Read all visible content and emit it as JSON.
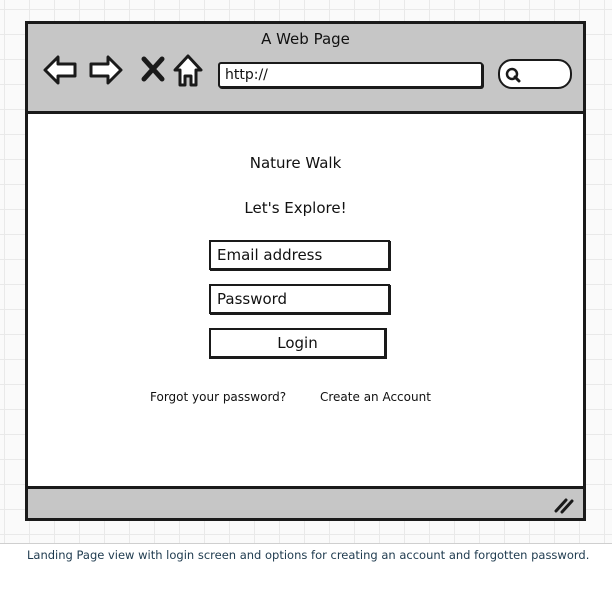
{
  "window": {
    "title": "A Web Page"
  },
  "toolbar": {
    "icons": [
      "back-arrow-icon",
      "forward-arrow-icon",
      "close-icon",
      "home-icon"
    ],
    "url_value": "http://",
    "search_icon": "search-icon"
  },
  "page": {
    "site_name": "Nature Walk",
    "tagline": "Let's Explore!",
    "email_placeholder": "Email address",
    "password_placeholder": "Password",
    "login_label": "Login",
    "forgot_link": "Forgot your password?",
    "create_link": "Create an Account"
  },
  "statusbar": {
    "grip_icon": "resize-grip-icon"
  },
  "caption": "Landing Page view with login screen and options for creating an account and forgotten password.",
  "colors": {
    "chrome": "#c6c6c6",
    "stroke": "#1a1a1a",
    "caption_text": "#1e3a4e"
  }
}
